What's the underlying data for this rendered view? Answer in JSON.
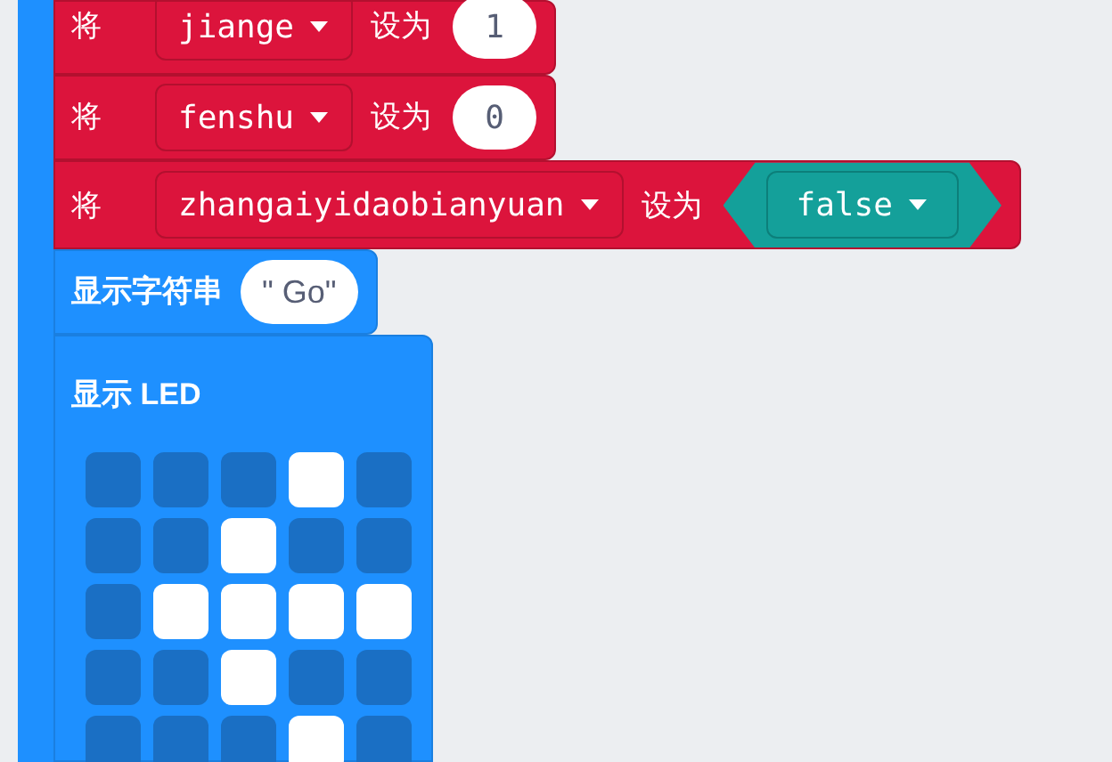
{
  "blocks": [
    {
      "kind": "set",
      "keyword": "将",
      "variable": "jiange",
      "action": "设为",
      "value": {
        "kind": "number",
        "text": "1"
      }
    },
    {
      "kind": "set",
      "keyword": "将",
      "variable": "fenshu",
      "action": "设为",
      "value": {
        "kind": "number",
        "text": "0"
      }
    },
    {
      "kind": "set",
      "keyword": "将",
      "variable": "zhangaiyidaobianyuan",
      "action": "设为",
      "value": {
        "kind": "boolean",
        "text": "false"
      }
    },
    {
      "kind": "show_string",
      "label": "显示字符串",
      "value": "\" Go\""
    },
    {
      "kind": "show_leds",
      "label": "显示 LED",
      "rows": [
        {
          "cells": [
            {
              "on": false
            },
            {
              "on": false
            },
            {
              "on": false
            },
            {
              "on": true
            },
            {
              "on": false
            }
          ]
        },
        {
          "cells": [
            {
              "on": false
            },
            {
              "on": false
            },
            {
              "on": true
            },
            {
              "on": false
            },
            {
              "on": false
            }
          ]
        },
        {
          "cells": [
            {
              "on": false
            },
            {
              "on": true
            },
            {
              "on": true
            },
            {
              "on": true
            },
            {
              "on": true
            }
          ]
        },
        {
          "cells": [
            {
              "on": false
            },
            {
              "on": false
            },
            {
              "on": true
            },
            {
              "on": false
            },
            {
              "on": false
            }
          ]
        },
        {
          "cells": [
            {
              "on": false
            },
            {
              "on": false
            },
            {
              "on": false
            },
            {
              "on": true
            },
            {
              "on": false
            }
          ]
        }
      ]
    }
  ]
}
